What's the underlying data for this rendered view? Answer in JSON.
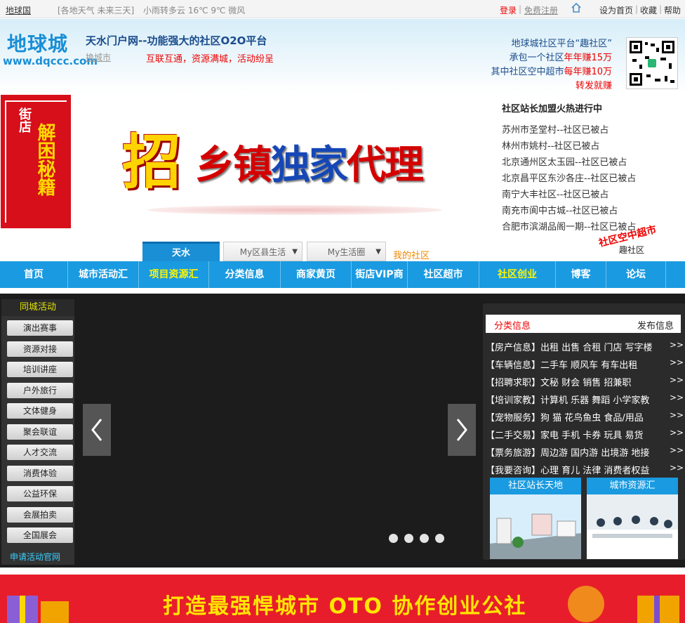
{
  "topbar": {
    "site_name": "地球国",
    "weather_links": "[各地天气 未来三天]",
    "weather_text": "小雨转多云  16℃  9℃  微风",
    "login": "登录",
    "register": "免费注册",
    "set_home": "设为首页",
    "favorite": "收藏",
    "help": "帮助"
  },
  "header": {
    "logo_cn": "地球城",
    "logo_url": "www.dqccc.com",
    "site_title": "天水门户网--功能强大的社区O2O平台",
    "switch_city": "换城市",
    "slogan": "互联互通，资源满城，活动纷呈",
    "promo_line1": "地球城社区平台“趣社区”",
    "promo_line2a": "承包一个社区",
    "promo_line2b": "年年赚15万",
    "promo_line3a": "其中社区空中超市",
    "promo_line3b": "每年赚10万",
    "promo_line4": "转发就赚"
  },
  "side_ad": {
    "line1": "街店",
    "line2": "解困秘籍"
  },
  "banner": {
    "zhao": "招",
    "rest_red": "乡镇",
    "rest_blue": "独家",
    "rest_red2": "代理"
  },
  "recruit": {
    "title": "社区站长加盟火热进行中",
    "items": [
      "苏州市圣堂村--社区已被占",
      "林州市姚村--社区已被占",
      "北京通州区太玉园--社区已被占",
      "北京昌平区东沙各庄--社区已被占",
      "南宁大丰社区--社区已被占",
      "南充市阆中古城--社区已被占",
      "合肥市滨湖品阁一期--社区已被占"
    ],
    "sky_market": "社区空中超市",
    "qu_community": "趣社区"
  },
  "city_tabs": {
    "current": "天水",
    "county": "My区县生活",
    "life": "My生活圈",
    "my_community": "我的社区"
  },
  "nav": [
    "首页",
    "城市活动汇",
    "项目资源汇",
    "分类信息",
    "商家黄页",
    "街店VIP商",
    "社区超市",
    "社区创业",
    "博客",
    "论坛"
  ],
  "left_panel": {
    "title": "同城活动",
    "buttons": [
      "演出赛事",
      "资源对接",
      "培训讲座",
      "户外旅行",
      "文体健身",
      "聚会联谊",
      "人才交流",
      "消费体验",
      "公益环保",
      "会展拍卖",
      "全国展会"
    ],
    "apply": "申请活动官网"
  },
  "slider": {
    "prev": "‹",
    "next": "›"
  },
  "classifieds": {
    "title": "分类信息",
    "publish": "发布信息",
    "rows": [
      "【房产信息】出租 出售 合租 门店 写字楼",
      "【车辆信息】二手车 顺风车 有车出租",
      "【招聘求职】文秘 财会 销售 招兼职",
      "【培训家教】计算机 乐器 舞蹈 小学家教",
      "【宠物服务】狗 猫 花鸟鱼虫 食品/用品",
      "【二手交易】家电 手机 卡券 玩具 易货",
      "【票务旅游】周边游 国内游 出境游 地接",
      "【我要咨询】心理 育儿 法律 消费者权益"
    ],
    "more": ">>",
    "card1": "社区站长天地",
    "card2": "城市资源汇"
  },
  "bottom_banner": {
    "text": "打造最强悍城市 OTO 协作创业公社"
  },
  "colors": {
    "brand_blue": "#1a9ae0",
    "accent_red": "#e00000",
    "highlight_yellow": "#fff600"
  }
}
